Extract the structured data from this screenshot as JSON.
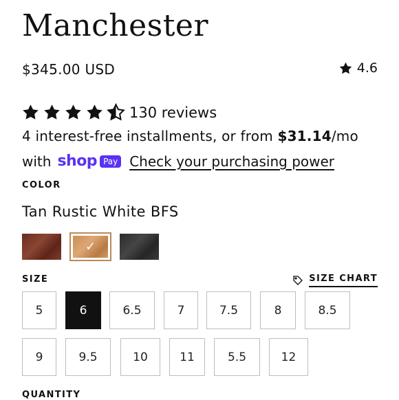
{
  "product": {
    "title": "Manchester",
    "price": "$345.00 USD",
    "rating_value": "4.6",
    "reviews_text": "130 reviews",
    "stars_full": 4,
    "stars_half": 1
  },
  "installments": {
    "prefix": "4 interest-free installments, or from ",
    "amount": "$31.14",
    "suffix": "/mo",
    "with": "with",
    "shop_logo": "shop",
    "pay_badge": "Pay",
    "link": "Check your purchasing power"
  },
  "color": {
    "label": "COLOR",
    "selected": "Tan Rustic White BFS",
    "swatches": [
      {
        "name": "dark-brown",
        "color": "#7a3626",
        "selected": false
      },
      {
        "name": "tan-rustic-white",
        "color": "#d49a60",
        "selected": true
      },
      {
        "name": "black",
        "color": "#333333",
        "selected": false
      }
    ]
  },
  "size": {
    "label": "SIZE",
    "chart_label": "SIZE CHART",
    "options": [
      "5",
      "6",
      "6.5",
      "7",
      "7.5",
      "8",
      "8.5",
      "9",
      "9.5",
      "10",
      "11",
      "5.5",
      "12"
    ],
    "selected": "6"
  },
  "quantity": {
    "label": "QUANTITY"
  },
  "icons": {
    "star": "star-icon",
    "tag": "tag-icon",
    "check": "check-icon"
  }
}
